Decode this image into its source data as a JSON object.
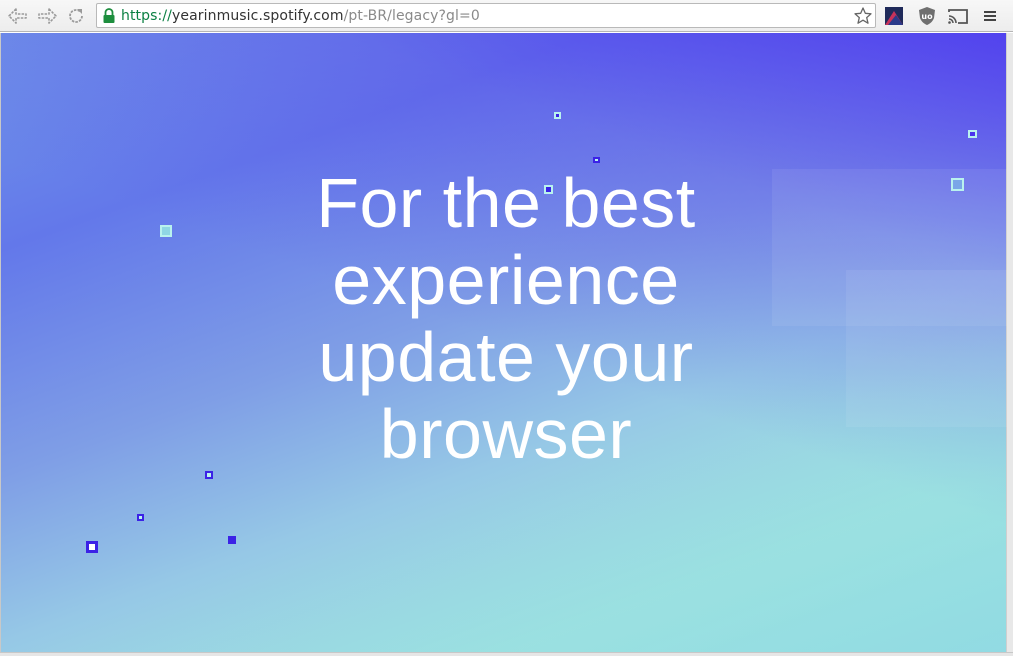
{
  "browser": {
    "back_icon": "back-arrow-icon",
    "forward_icon": "forward-arrow-icon",
    "reload_icon": "reload-icon",
    "secure_icon": "lock-icon",
    "bookmark_icon": "star-icon",
    "address": {
      "scheme": "https://",
      "host": "yearinmusic.spotify.com",
      "path": "/pt-BR/legacy?gl=0"
    },
    "extensions": [
      "extension-icon",
      "ublock-icon",
      "cast-icon",
      "menu-icon"
    ]
  },
  "page": {
    "headline": {
      "line1": "For the best",
      "line2": "experience",
      "line3": "update your",
      "line4": "browser"
    },
    "colors": {
      "gradient_top": "#4a34ee",
      "gradient_bottom": "#9eeedc",
      "text": "#ffffff",
      "pixel_dark": "#3b22e6",
      "pixel_light": "#b9f2ee"
    }
  }
}
